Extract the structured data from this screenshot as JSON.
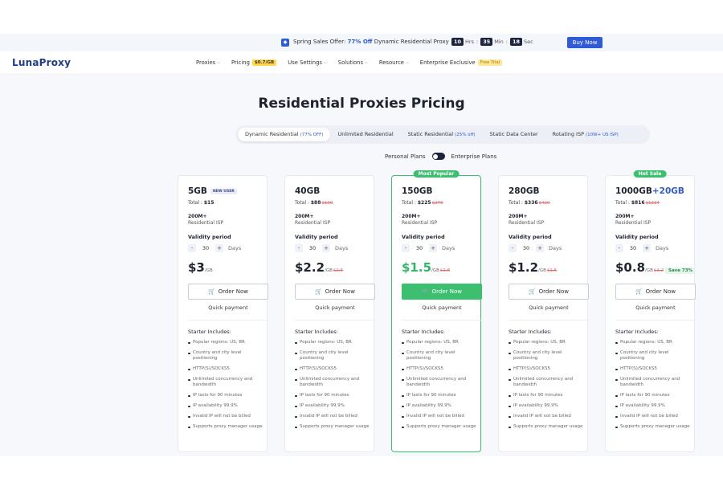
{
  "promo": {
    "text_prefix": "Spring Sales Offer: ",
    "highlight": "77% Off",
    "text_suffix": " Dynamic Residential Proxy",
    "timer": [
      {
        "value": "10",
        "unit": "Hrs"
      },
      {
        "value": "35",
        "unit": "Min"
      },
      {
        "value": "18",
        "unit": "Sec"
      }
    ],
    "buy_label": "Buy Now"
  },
  "nav": {
    "logo": "LunaProxy",
    "items": [
      {
        "label": "Proxies",
        "chevron": true
      },
      {
        "label": "Pricing",
        "tag": "$0.7/GB"
      },
      {
        "label": "Use Settings",
        "chevron": true
      },
      {
        "label": "Solutions",
        "chevron": true
      },
      {
        "label": "Resource",
        "chevron": true
      },
      {
        "label": "Enterprise Exclusive",
        "tag": "Free Trial"
      }
    ]
  },
  "page": {
    "title": "Residential Proxies Pricing"
  },
  "tabs": [
    {
      "label": "Dynamic Residential",
      "badge": "(77% OFF)",
      "active": true
    },
    {
      "label": "Unlimited Residential",
      "badge": ""
    },
    {
      "label": "Static Residential",
      "badge": "(25% off)"
    },
    {
      "label": "Static Data Center",
      "badge": ""
    },
    {
      "label": "Rotating ISP",
      "badge": "(10W+ US ISP)"
    }
  ],
  "plans_toggle": {
    "personal": "Personal Plans",
    "enterprise": "Enterprise Plans"
  },
  "cards": [
    {
      "size": "5GB",
      "extra": "",
      "tag": "NEW USER",
      "ribbon": "",
      "total_label": "Total : ",
      "total": "$15",
      "total_old": "",
      "ips": "200M+",
      "ip_type": "Residential ISP",
      "validity": "Validity period",
      "days": "30",
      "days_unit": "Days",
      "price": "$3",
      "price_unit": "/GB",
      "price_old": "",
      "save": "",
      "order": "Order Now",
      "quick": "Quick payment",
      "green": false
    },
    {
      "size": "40GB",
      "extra": "",
      "tag": "",
      "ribbon": "",
      "total_label": "Total : ",
      "total": "$88",
      "total_old": "$100",
      "ips": "200M+",
      "ip_type": "Residential ISP",
      "validity": "Validity period",
      "days": "30",
      "days_unit": "Days",
      "price": "$2.2",
      "price_unit": "/GB",
      "price_old": "$2.5",
      "save": "",
      "order": "Order Now",
      "quick": "Quick payment",
      "green": false
    },
    {
      "size": "150GB",
      "extra": "",
      "tag": "",
      "ribbon": "Most Popular",
      "total_label": "Total : ",
      "total": "$225",
      "total_old": "$270",
      "ips": "200M+",
      "ip_type": "Residential ISP",
      "validity": "Validity period",
      "days": "30",
      "days_unit": "Days",
      "price": "$1.5",
      "price_unit": "/GB",
      "price_old": "$1.8",
      "save": "",
      "order": "Order Now",
      "quick": "Quick payment",
      "green": true
    },
    {
      "size": "280GB",
      "extra": "",
      "tag": "",
      "ribbon": "",
      "total_label": "Total : ",
      "total": "$336",
      "total_old": "$420",
      "ips": "200M+",
      "ip_type": "Residential ISP",
      "validity": "Validity period",
      "days": "30",
      "days_unit": "Days",
      "price": "$1.2",
      "price_unit": "/GB",
      "price_old": "$1.5",
      "save": "",
      "order": "Order Now",
      "quick": "Quick payment",
      "green": false
    },
    {
      "size": "1000GB",
      "extra": "+20GB",
      "tag": "",
      "ribbon": "Hot Sale",
      "total_label": "Total : ",
      "total": "$816",
      "total_old": "$1224",
      "ips": "200M+",
      "ip_type": "Residential ISP",
      "validity": "Validity period",
      "days": "30",
      "days_unit": "Days",
      "price": "$0.8",
      "price_unit": "/GB",
      "price_old": "$1.2",
      "save": "Save 73%",
      "order": "Order Now",
      "quick": "Quick payment",
      "green": false
    }
  ],
  "features_title": "Starter Includes:",
  "features": [
    "Popular regions: US, BR",
    "Country and city level positioning",
    "HTTP(S)/SOCKS5",
    "Unlimited concurrency and bandwidth",
    "IP lasts for 90 minutes",
    "IP availability 99.9%",
    "Invalid IP will not be billed",
    "Supports proxy manager usage"
  ],
  "colors": {
    "accent": "#2f5bd8",
    "popular": "#3cbf6e",
    "dark": "#1f2330",
    "strike": "#e06a6a",
    "background": "#f6f8fb"
  }
}
